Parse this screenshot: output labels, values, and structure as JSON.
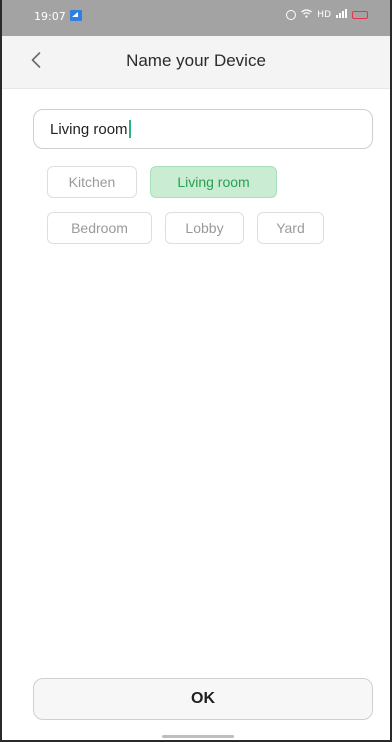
{
  "status_bar": {
    "time": "19:07",
    "signal_text": "HD"
  },
  "header": {
    "title": "Name your Device"
  },
  "name_input": {
    "value": "Living room"
  },
  "suggestions": [
    {
      "label": "Kitchen",
      "selected": false
    },
    {
      "label": "Living room",
      "selected": true
    },
    {
      "label": "Bedroom",
      "selected": false
    },
    {
      "label": "Lobby",
      "selected": false
    },
    {
      "label": "Yard",
      "selected": false
    }
  ],
  "footer": {
    "ok_label": "OK"
  },
  "colors": {
    "accent_green": "#2aa052",
    "selected_chip_bg": "#c9ecd3",
    "battery_red": "#e8344a",
    "statusbar_grey": "#a3a3a3"
  }
}
